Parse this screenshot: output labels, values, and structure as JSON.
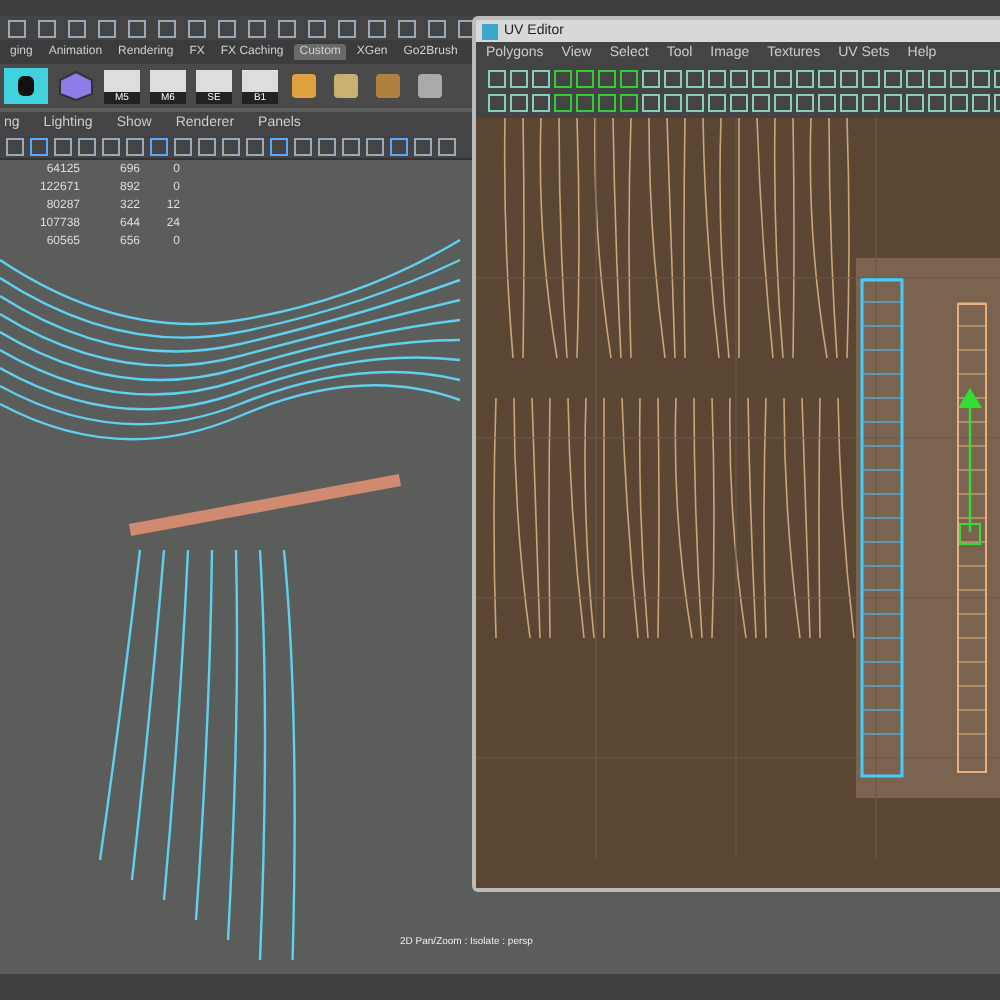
{
  "shelf_tabs": [
    {
      "label": "ging",
      "selected": false
    },
    {
      "label": "Animation",
      "selected": false
    },
    {
      "label": "Rendering",
      "selected": false
    },
    {
      "label": "FX",
      "selected": false
    },
    {
      "label": "FX Caching",
      "selected": false
    },
    {
      "label": "Custom",
      "selected": true
    },
    {
      "label": "XGen",
      "selected": false
    },
    {
      "label": "Go2Brush",
      "selected": false
    }
  ],
  "shelf_icon_labels": [
    "M5",
    "M6",
    "SE",
    "B1"
  ],
  "panel_menu": [
    "ng",
    "Lighting",
    "Show",
    "Renderer",
    "Panels"
  ],
  "hud_stats": [
    [
      "64125",
      "696",
      "0"
    ],
    [
      "122671",
      "892",
      "0"
    ],
    [
      "80287",
      "322",
      "12"
    ],
    [
      "107738",
      "644",
      "24"
    ],
    [
      "60565",
      "656",
      "0"
    ]
  ],
  "uv_editor": {
    "title": "UV Editor",
    "menu": [
      "Polygons",
      "View",
      "Select",
      "Tool",
      "Image",
      "Textures",
      "UV Sets",
      "Help"
    ]
  },
  "viewport_status": "2D Pan/Zoom : Isolate : persp"
}
